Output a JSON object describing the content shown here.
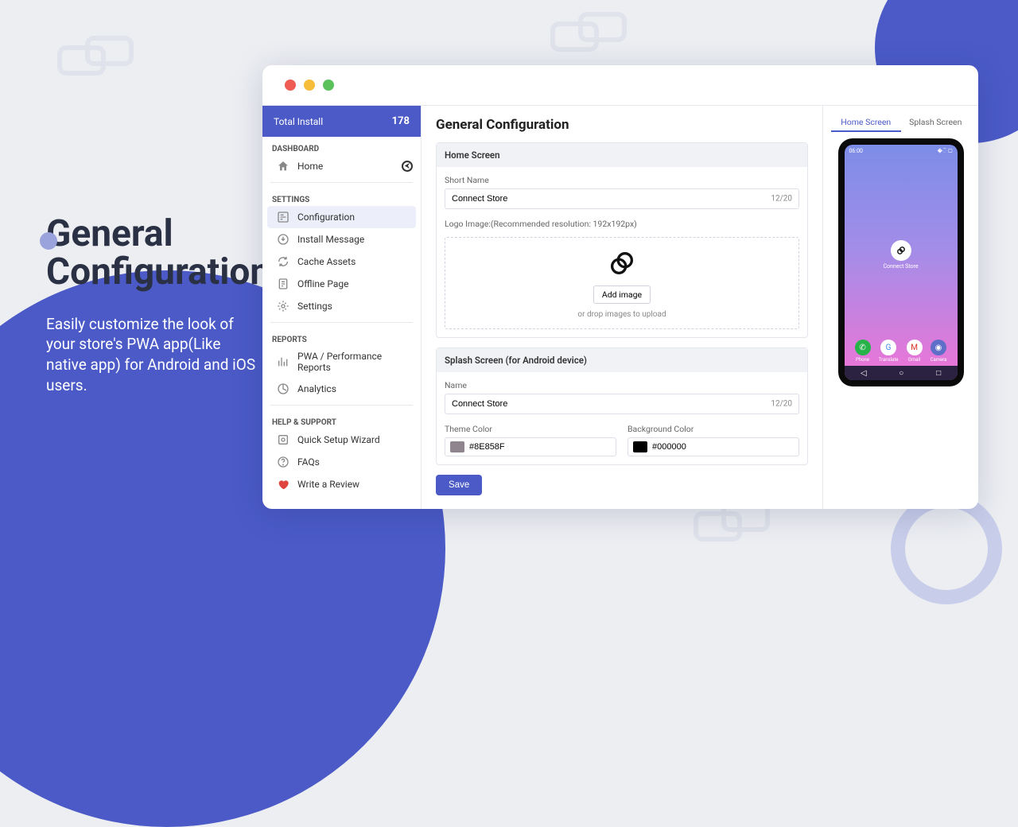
{
  "hero": {
    "title_line1": "General",
    "title_line2": "Configuration",
    "desc": "Easily customize the look of your store's PWA app(Like native app) for Android and iOS users."
  },
  "sidebar": {
    "install_label": "Total Install",
    "install_count": "178",
    "sections": {
      "dashboard": "DASHBOARD",
      "settings": "SETTINGS",
      "reports": "REPORTS",
      "help": "HELP & SUPPORT"
    },
    "items": {
      "home": "Home",
      "configuration": "Configuration",
      "install_message": "Install Message",
      "cache_assets": "Cache Assets",
      "offline_page": "Offline Page",
      "settings": "Settings",
      "perf": "PWA / Performance Reports",
      "analytics": "Analytics",
      "wizard": "Quick Setup Wizard",
      "faqs": "FAQs",
      "review": "Write a Review"
    }
  },
  "main": {
    "title": "General Configuration",
    "home_screen": {
      "header": "Home Screen",
      "short_name_label": "Short Name",
      "short_name_value": "Connect Store",
      "short_name_count": "12/20",
      "logo_label": "Logo Image:(Recommended resolution: 192x192px)",
      "add_image": "Add image",
      "drop_hint": "or drop images to upload"
    },
    "splash": {
      "header": "Splash Screen (for Android device)",
      "name_label": "Name",
      "name_value": "Connect Store",
      "name_count": "12/20",
      "theme_label": "Theme Color",
      "theme_value": "#8E858F",
      "bg_label": "Background Color",
      "bg_value": "#000000"
    },
    "save": "Save"
  },
  "preview": {
    "tab_home": "Home Screen",
    "tab_splash": "Splash Screen",
    "time": "06:00",
    "app_label": "Connect Store",
    "dock": {
      "phone": "Phone",
      "translate": "Translate",
      "gmail": "Gmail",
      "camera": "Camera"
    }
  },
  "colors": {
    "theme_swatch": "#8e858f",
    "bg_swatch": "#000000"
  }
}
